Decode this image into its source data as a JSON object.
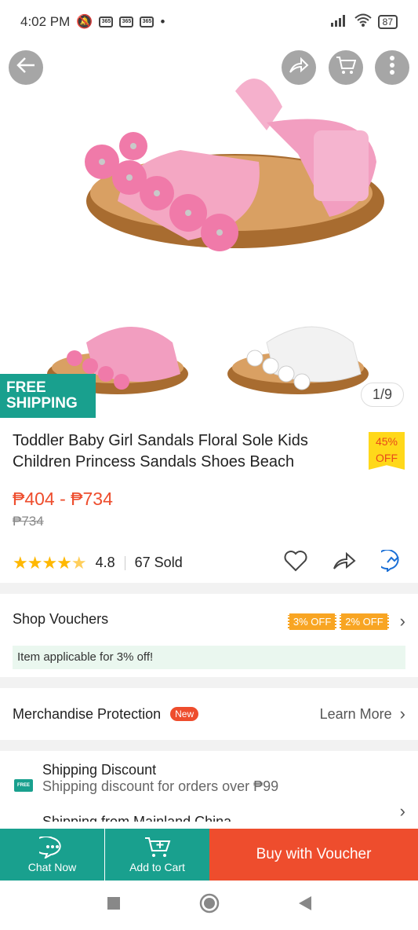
{
  "status_bar": {
    "time": "4:02 PM",
    "battery": "87"
  },
  "gallery": {
    "counter": "1/9",
    "badge_line1": "FREE",
    "badge_line2": "SHIPPING"
  },
  "product": {
    "title": "Toddler Baby Girl Sandals Floral Sole Kids Children Princess Sandals Shoes Beach",
    "discount_percent": "45%",
    "discount_off": "OFF",
    "price": "₱404 - ₱734",
    "original_price": "₱734",
    "rating": "4.8",
    "sold": "67 Sold",
    "stars": 4.8
  },
  "vouchers": {
    "title": "Shop Vouchers",
    "tags": [
      "3% OFF",
      "2% OFF"
    ],
    "applicable": "Item applicable for 3% off!"
  },
  "protection": {
    "title": "Merchandise Protection",
    "badge": "New",
    "link": "Learn More"
  },
  "shipping": {
    "title": "Shipping Discount",
    "subtitle": "Shipping discount for orders over ₱99",
    "next": "Shipping from Mainland China",
    "truck_label": "FREE"
  },
  "actions": {
    "chat": "Chat Now",
    "cart": "Add to Cart",
    "buy": "Buy with Voucher"
  },
  "colors": {
    "brand_teal": "#19a08e",
    "brand_orange": "#ee4d2d",
    "star": "#ffb800"
  }
}
